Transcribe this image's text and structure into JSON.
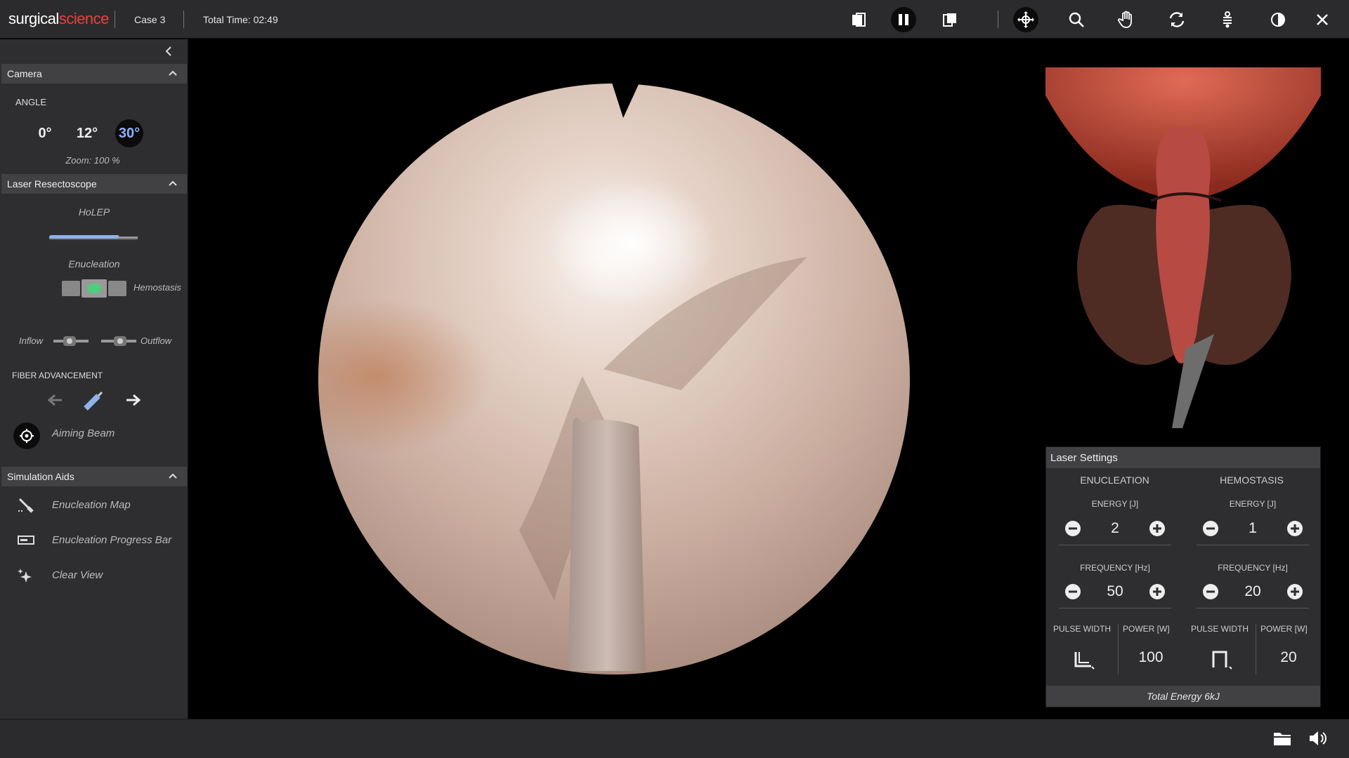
{
  "header": {
    "logo_a": "surgical",
    "logo_b": "science",
    "case": "Case 3",
    "total_time": "Total Time: 02:49"
  },
  "toolbar_icons": [
    "layout-left-icon",
    "pause-icon",
    "layout-right-icon",
    "move-icon",
    "zoom-icon",
    "hand-icon",
    "rotate-icon",
    "link-icon",
    "contrast-icon",
    "close-icon"
  ],
  "sidebar": {
    "camera": {
      "title": "Camera",
      "angle_label": "ANGLE",
      "angles": [
        "0°",
        "12°",
        "30°"
      ],
      "selected_angle": "30°",
      "zoom": "Zoom: 100 %"
    },
    "laser": {
      "title": "Laser Resectoscope",
      "mode": "HoLEP",
      "enucleation": "Enucleation",
      "hemostasis": "Hemostasis",
      "inflow": "Inflow",
      "outflow": "Outflow",
      "fiber_label": "FIBER ADVANCEMENT",
      "aiming_beam": "Aiming Beam"
    },
    "aids": {
      "title": "Simulation Aids",
      "items": [
        "Enucleation Map",
        "Enucleation Progress Bar",
        "Clear View"
      ]
    }
  },
  "laser_settings": {
    "title": "Laser Settings",
    "tabs": [
      "ENUCLEATION",
      "HEMOSTASIS"
    ],
    "energy_label": "ENERGY [J]",
    "frequency_label": "FREQUENCY [Hz]",
    "pulse_label": "PULSE WIDTH",
    "power_label": "POWER [W]",
    "enucleation": {
      "energy": "2",
      "frequency": "50",
      "power": "100"
    },
    "hemostasis": {
      "energy": "1",
      "frequency": "20",
      "power": "20"
    },
    "total": "Total Energy 6kJ"
  },
  "colors": {
    "brand_red": "#e8423a",
    "accent_blue": "#8fb0ff",
    "panel_bg": "#2e2e30"
  }
}
